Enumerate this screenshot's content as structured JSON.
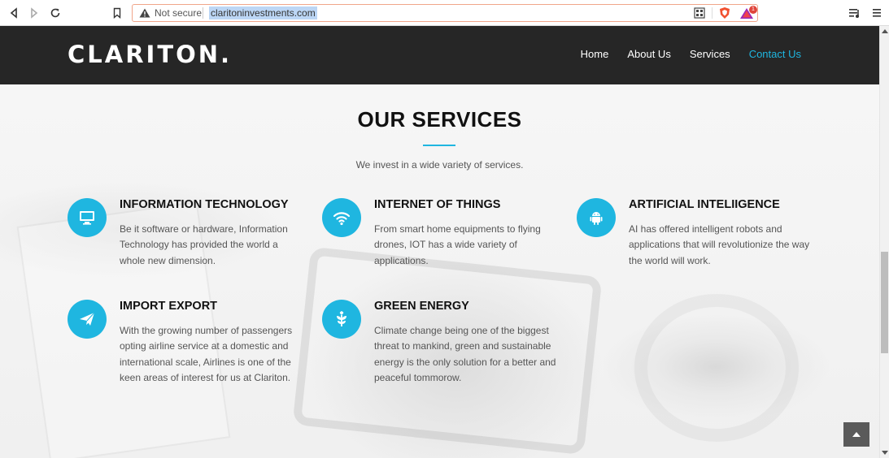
{
  "browser": {
    "security_label": "Not secure",
    "url": "claritoninvestments.com",
    "rewards_badge": "1"
  },
  "site": {
    "logo": "CLARITON.",
    "nav": [
      {
        "label": "Home",
        "active": false
      },
      {
        "label": "About Us",
        "active": false
      },
      {
        "label": "Services",
        "active": false
      },
      {
        "label": "Contact Us",
        "active": true
      }
    ]
  },
  "services_section": {
    "title": "OUR SERVICES",
    "subtitle": "We invest in a wide variety of services.",
    "items": [
      {
        "icon": "monitor-icon",
        "title": "INFORMATION TECHNOLOGY",
        "text": "Be it software or hardware, Information Technology has provided the world a whole new dimension."
      },
      {
        "icon": "wifi-icon",
        "title": "INTERNET OF THINGS",
        "text": "From smart home equipments to flying drones, IOT has a wide variety of applications."
      },
      {
        "icon": "android-icon",
        "title": "ARTIFICIAL INTELIIGENCE",
        "text": "AI has offered intelligent robots and applications that will revolutionize the way the world will work."
      },
      {
        "icon": "paper-plane-icon",
        "title": "IMPORT EXPORT",
        "text": "With the growing number of passengers opting airline service at a domestic and international scale, Airlines is one of the keen areas of interest for us at Clariton."
      },
      {
        "icon": "leaf-icon",
        "title": "GREEN ENERGY",
        "text": "Climate change being one of the biggest threat to mankind, green and sustainable energy is the only solution for a better and peaceful tommorow."
      }
    ]
  },
  "colors": {
    "accent": "#1fb6e0",
    "header_bg": "#262626",
    "back_to_top_bg": "#5a5a5a"
  }
}
